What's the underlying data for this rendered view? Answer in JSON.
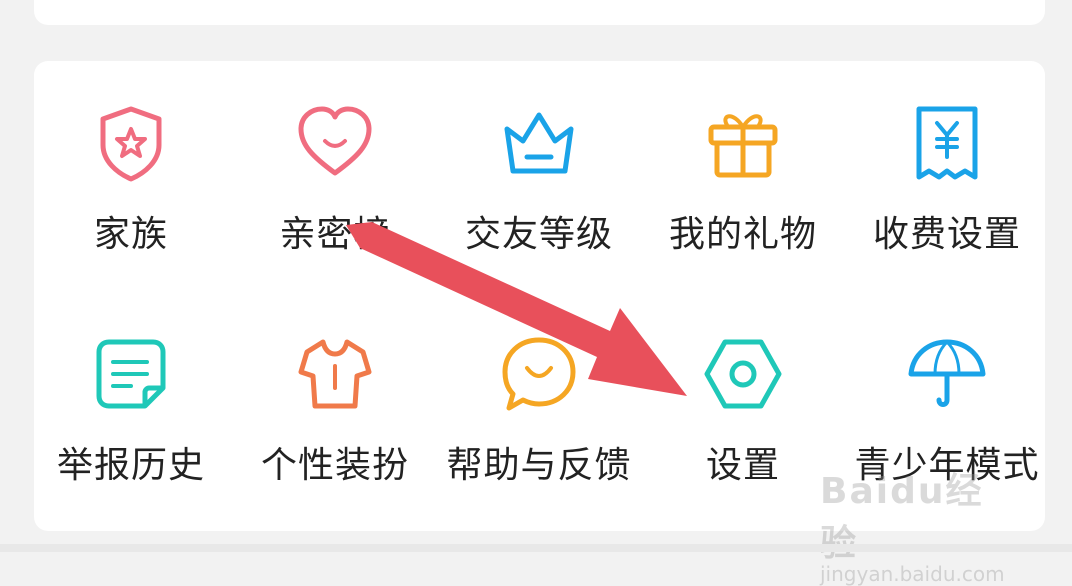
{
  "menu": {
    "row1": [
      {
        "label": "家族",
        "icon": "shield-star-icon",
        "color": "#f06d80"
      },
      {
        "label": "亲密榜",
        "icon": "heart-icon",
        "color": "#f06d80"
      },
      {
        "label": "交友等级",
        "icon": "crown-icon",
        "color": "#1aa3e8"
      },
      {
        "label": "我的礼物",
        "icon": "gift-icon",
        "color": "#f5a623"
      },
      {
        "label": "收费设置",
        "icon": "receipt-yen-icon",
        "color": "#1aa3e8"
      }
    ],
    "row2": [
      {
        "label": "举报历史",
        "icon": "note-icon",
        "color": "#1fc8b8"
      },
      {
        "label": "个性装扮",
        "icon": "shirt-icon",
        "color": "#f07a4a"
      },
      {
        "label": "帮助与反馈",
        "icon": "chat-bubble-icon",
        "color": "#f5a623"
      },
      {
        "label": "设置",
        "icon": "hex-nut-icon",
        "color": "#1fc8b8"
      },
      {
        "label": "青少年模式",
        "icon": "umbrella-icon",
        "color": "#1aa3e8"
      }
    ]
  },
  "annotation": {
    "arrow_color": "#e8505b"
  },
  "watermark": {
    "logo": "Baidu经验",
    "url": "jingyan.baidu.com"
  }
}
